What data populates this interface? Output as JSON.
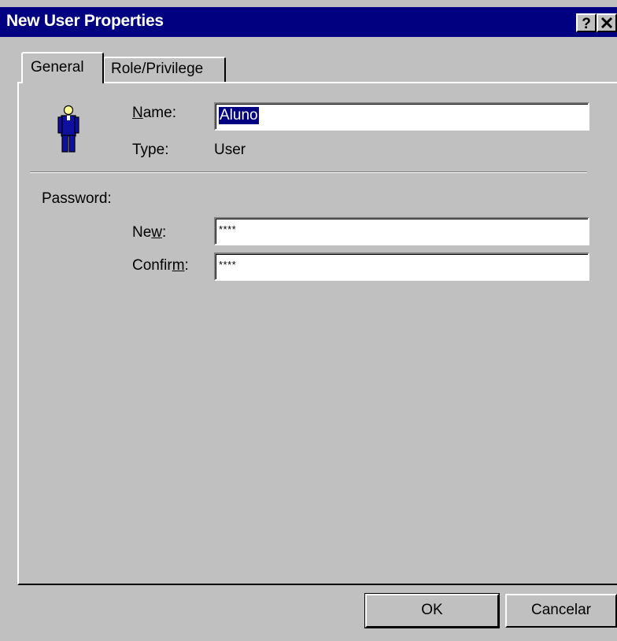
{
  "window": {
    "title": "New User Properties",
    "help_button": "?",
    "close_button": "✕"
  },
  "tabs": [
    {
      "label": "General",
      "active": true
    },
    {
      "label": "Role/Privilege",
      "active": false
    }
  ],
  "general": {
    "icon": "user-icon",
    "name": {
      "label_pre": "",
      "label_ul": "N",
      "label_post": "ame:",
      "value": "Aluno"
    },
    "type": {
      "label": "Type:",
      "value": "User"
    },
    "password": {
      "section_label": "Password:",
      "new": {
        "label_pre": "Ne",
        "label_ul": "w",
        "label_post": ":",
        "value": "****"
      },
      "confirm": {
        "label_pre": "Confir",
        "label_ul": "m",
        "label_post": ":",
        "value": "****"
      }
    }
  },
  "buttons": {
    "ok": "OK",
    "cancel": "Cancelar"
  },
  "colors": {
    "titlebar": "#000080",
    "face": "#c0c0c0",
    "selection": "#000080"
  }
}
